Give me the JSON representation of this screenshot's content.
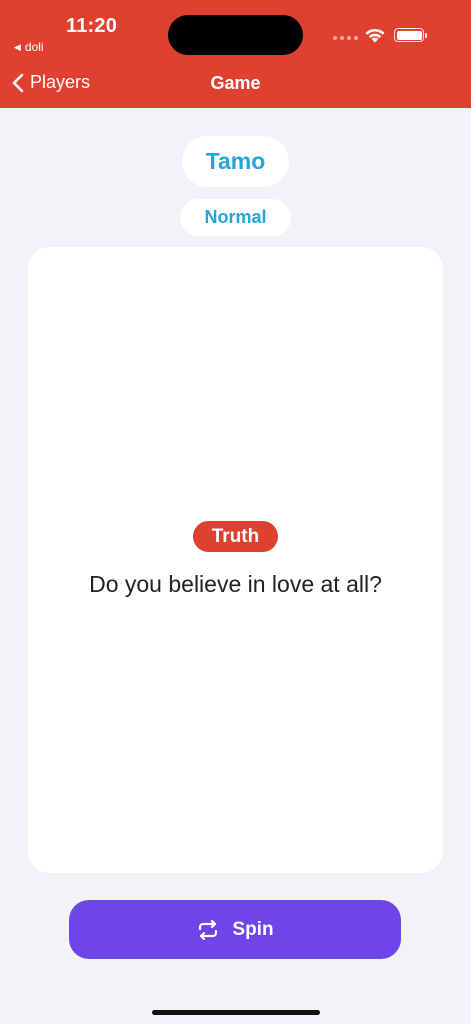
{
  "status_bar": {
    "time": "11:20",
    "back_app_label": "doli"
  },
  "nav": {
    "back_label": "Players",
    "title": "Game"
  },
  "player": {
    "name": "Tamo"
  },
  "mode": {
    "label": "Normal"
  },
  "card": {
    "type": "Truth",
    "question": "Do you believe in love at all?"
  },
  "spin_button": {
    "label": "Spin"
  },
  "colors": {
    "header": "#e04030",
    "accent_text": "#22a6dc",
    "truth_badge": "#e04030",
    "spin_button": "#6e45e8",
    "background": "#f2f2f7"
  },
  "icons": [
    "back-chevron-icon",
    "wifi-icon",
    "battery-icon",
    "repeat-icon"
  ]
}
